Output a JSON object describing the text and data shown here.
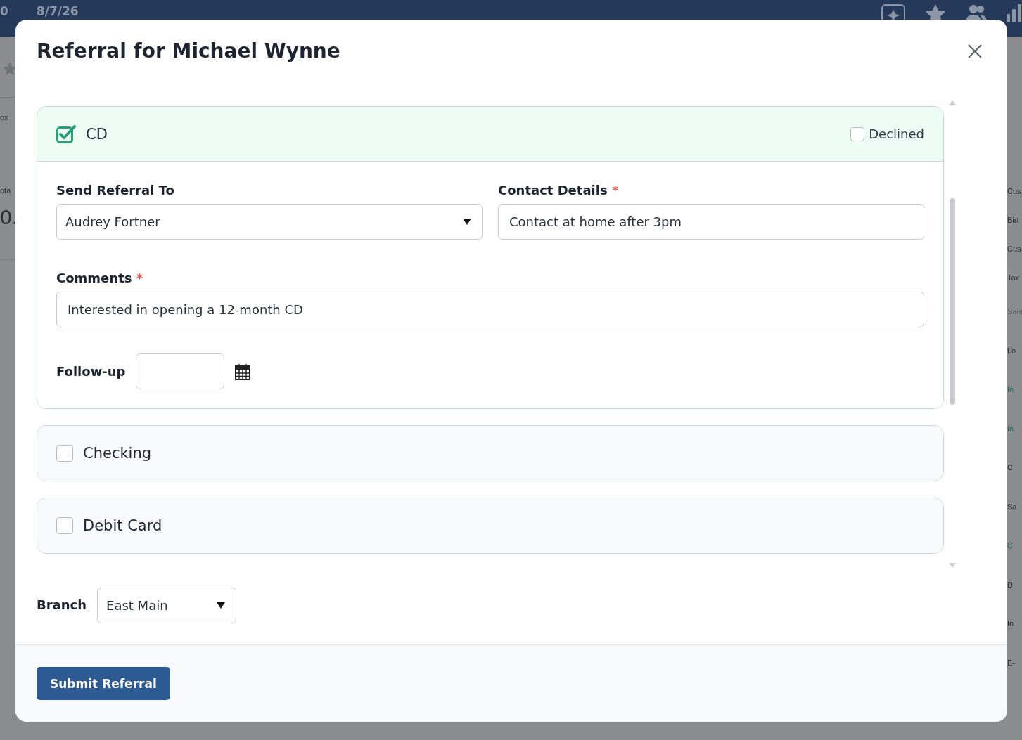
{
  "background": {
    "top_bar": {
      "fragment": "0",
      "date": "8/7/26"
    },
    "left_fragments": [
      {
        "text": "ox",
        "kind": "label"
      },
      {
        "text": "ota",
        "kind": "label"
      },
      {
        "text": "0.",
        "kind": "amount"
      }
    ],
    "right_fragments": [
      {
        "text": "Cus",
        "kind": "label"
      },
      {
        "text": "Birt",
        "kind": "label"
      },
      {
        "text": "Cus",
        "kind": "label"
      },
      {
        "text": "Tax",
        "kind": "label"
      },
      {
        "text": "Sale",
        "kind": "heading"
      },
      {
        "text": "Lo",
        "kind": "label"
      },
      {
        "text": "In",
        "kind": "link"
      },
      {
        "text": "In",
        "kind": "link"
      },
      {
        "text": "C",
        "kind": "label"
      },
      {
        "text": "Sa",
        "kind": "label"
      },
      {
        "text": "C",
        "kind": "link"
      },
      {
        "text": "D",
        "kind": "label"
      },
      {
        "text": "In",
        "kind": "label"
      },
      {
        "text": "E-",
        "kind": "label"
      }
    ]
  },
  "modal": {
    "title": "Referral for Michael Wynne",
    "products": [
      {
        "name": "CD",
        "checked": true,
        "expanded": true,
        "declined_label": "Declined",
        "declined": false,
        "form": {
          "send_to": {
            "label": "Send Referral To",
            "value": "Audrey Fortner"
          },
          "contact": {
            "label": "Contact Details",
            "marker": "*",
            "value": "Contact at home after 3pm"
          },
          "comments": {
            "label": "Comments",
            "marker": "*",
            "value": "Interested in opening a 12-month CD"
          },
          "follow_up": {
            "label": "Follow-up"
          }
        }
      },
      {
        "name": "Checking",
        "checked": false,
        "expanded": false
      },
      {
        "name": "Debit Card",
        "checked": false,
        "expanded": false
      }
    ],
    "branch": {
      "label": "Branch",
      "value": "East Main"
    },
    "submit": "Submit Referral"
  }
}
